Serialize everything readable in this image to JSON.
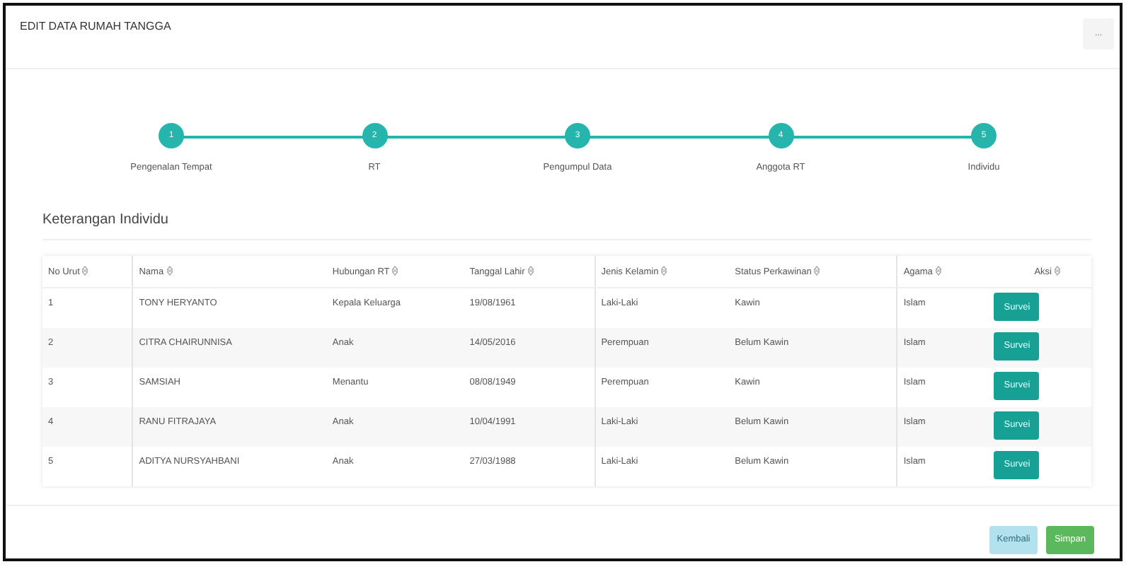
{
  "header": {
    "title": "EDIT DATA RUMAH TANGGA",
    "menu_button": "..."
  },
  "steps": [
    {
      "number": "1",
      "label": "Pengenalan Tempat"
    },
    {
      "number": "2",
      "label": "RT"
    },
    {
      "number": "3",
      "label": "Pengumpul Data"
    },
    {
      "number": "4",
      "label": "Anggota RT"
    },
    {
      "number": "5",
      "label": "Individu"
    }
  ],
  "section_title": "Keterangan Individu",
  "table": {
    "columns": [
      "No Urut",
      "Nama",
      "Hubungan RT",
      "Tanggal Lahir",
      "Jenis Kelamin",
      "Status Perkawinan",
      "Agama",
      "Aksi"
    ],
    "rows": [
      {
        "cells": [
          "1",
          "TONY HERYANTO",
          "Kepala Keluarga",
          "19/08/1961",
          "Laki-Laki",
          "Kawin",
          "Islam"
        ],
        "action": "Survei"
      },
      {
        "cells": [
          "2",
          "CITRA CHAIRUNNISA",
          "Anak",
          "14/05/2016",
          "Perempuan",
          "Belum Kawin",
          "Islam"
        ],
        "action": "Survei"
      },
      {
        "cells": [
          "3",
          "SAMSIAH",
          "Menantu",
          "08/08/1949",
          "Perempuan",
          "Kawin",
          "Islam"
        ],
        "action": "Survei"
      },
      {
        "cells": [
          "4",
          "RANU FITRAJAYA",
          "Anak",
          "10/04/1991",
          "Laki-Laki",
          "Belum Kawin",
          "Islam"
        ],
        "action": "Survei"
      },
      {
        "cells": [
          "5",
          "ADITYA NURSYAHBANI",
          "Anak",
          "27/03/1988",
          "Laki-Laki",
          "Belum Kawin",
          "Islam"
        ],
        "action": "Survei"
      }
    ]
  },
  "footer_buttons": [
    {
      "label": "Kembali",
      "kind": "back",
      "disabled": true
    },
    {
      "label": "Simpan",
      "kind": "save",
      "disabled": false
    }
  ]
}
